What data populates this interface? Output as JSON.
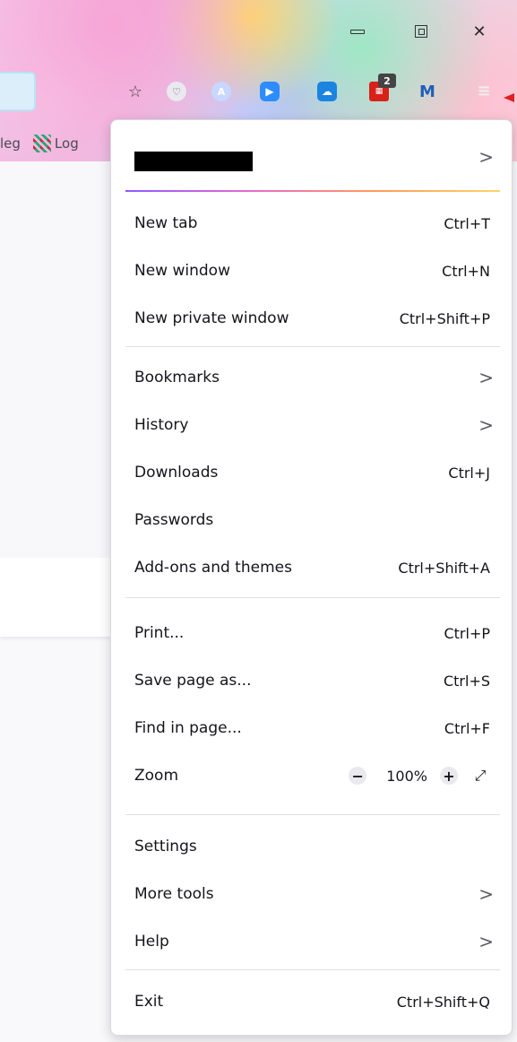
{
  "toolbar": {
    "badge_count": "2",
    "bookmarks_bar": [
      {
        "label": "leg"
      },
      {
        "label": "Log"
      }
    ]
  },
  "menu": {
    "account_chevron": ">",
    "groups": [
      [
        {
          "label": "New tab",
          "shortcut": "Ctrl+T"
        },
        {
          "label": "New window",
          "shortcut": "Ctrl+N"
        },
        {
          "label": "New private window",
          "shortcut": "Ctrl+Shift+P"
        }
      ],
      [
        {
          "label": "Bookmarks",
          "submenu": true
        },
        {
          "label": "History",
          "submenu": true
        },
        {
          "label": "Downloads",
          "shortcut": "Ctrl+J"
        },
        {
          "label": "Passwords"
        },
        {
          "label": "Add-ons and themes",
          "shortcut": "Ctrl+Shift+A"
        }
      ],
      [
        {
          "label": "Print...",
          "shortcut": "Ctrl+P"
        },
        {
          "label": "Save page as...",
          "shortcut": "Ctrl+S"
        },
        {
          "label": "Find in page...",
          "shortcut": "Ctrl+F"
        }
      ],
      [
        {
          "label": "Settings"
        },
        {
          "label": "More tools",
          "submenu": true
        },
        {
          "label": "Help",
          "submenu": true
        }
      ],
      [
        {
          "label": "Exit",
          "shortcut": "Ctrl+Shift+Q"
        }
      ]
    ],
    "zoom": {
      "label": "Zoom",
      "value": "100%",
      "minus": "−",
      "plus": "+",
      "fullscreen": "⤢"
    }
  },
  "colors": {
    "accent_start": "#9059ff",
    "accent_end": "#ffd567",
    "arrow": "#e02020"
  }
}
